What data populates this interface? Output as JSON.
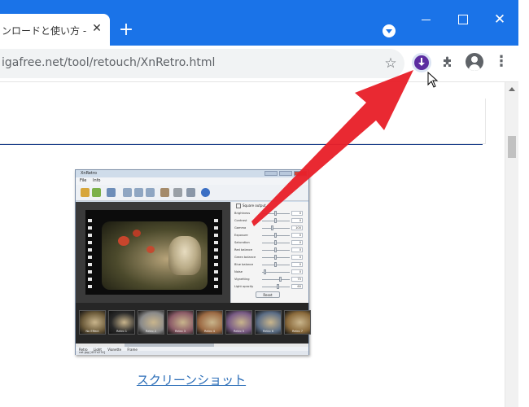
{
  "browser": {
    "tab": {
      "title": "ンロードと使い方 - k",
      "close_icon": "close-icon"
    },
    "new_tab_icon": "plus-icon",
    "tab_search_icon": "chevron-down-icon",
    "window_controls": [
      "minimize-icon",
      "maximize-icon",
      "close-icon"
    ],
    "toolbar": {
      "url": "igafree.net/tool/retouch/XnRetro.html",
      "bookmark_icon": "star-icon",
      "extension_icon": "download-extension-icon",
      "extensions_icon": "puzzle-icon",
      "profile_icon": "profile-icon",
      "menu_icon": "more-vert-icon"
    },
    "accent_color": "#1a73e8"
  },
  "page": {
    "screenshot_app": {
      "title": "XnRetro",
      "menu": [
        "File",
        "Info"
      ],
      "panel": {
        "square_output": "Square output",
        "sliders": [
          {
            "label": "Brightness",
            "value": "0"
          },
          {
            "label": "Contrast",
            "value": "0"
          },
          {
            "label": "Gamma",
            "value": "100"
          },
          {
            "label": "Exposure",
            "value": "0"
          },
          {
            "label": "Saturation",
            "value": "0"
          },
          {
            "label": "Red balance",
            "value": "0"
          },
          {
            "label": "Green balance",
            "value": "0"
          },
          {
            "label": "Blue balance",
            "value": "0"
          },
          {
            "label": "Noise",
            "value": "0"
          },
          {
            "label": "Vignetting",
            "value": "75"
          },
          {
            "label": "Light opacity",
            "value": "60"
          }
        ],
        "reset_label": "Reset"
      },
      "thumbnails": [
        "No Effect",
        "Retro 1",
        "Retro 2",
        "Retro 3",
        "Retro 4",
        "Retro 5",
        "Retro 6",
        "Retro 7"
      ],
      "tabs": [
        "Retro",
        "Light",
        "Vignette",
        "Frame"
      ],
      "status": "cat.jpg [437x274]"
    },
    "caption_link": "スクリーンショット",
    "arrow_color": "#e8202a"
  }
}
